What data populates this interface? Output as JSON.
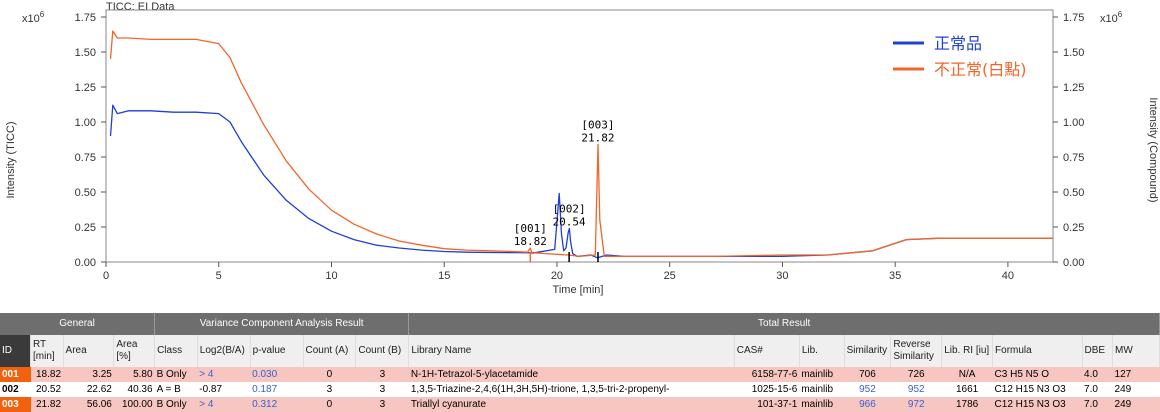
{
  "chart_data": {
    "type": "line",
    "title": "TICC: EI Data",
    "xlabel": "Time [min]",
    "ylabel_left": "Intensity (TICC)",
    "ylabel_right": "Intensity (Compound)",
    "y_multiplier": "x10",
    "y_exponent": "6",
    "xlim": [
      0,
      42
    ],
    "ylim": [
      0,
      1.8
    ],
    "x_ticks": [
      0,
      5,
      10,
      15,
      20,
      25,
      30,
      35,
      40
    ],
    "y_ticks": [
      0.0,
      0.25,
      0.5,
      0.75,
      1.0,
      1.25,
      1.5,
      1.75
    ],
    "y_tick_labels": [
      "0.00",
      "0.25",
      "0.50",
      "0.75",
      "1.00",
      "1.25",
      "1.50",
      "1.75"
    ],
    "legend_position": "top-right",
    "series": [
      {
        "name": "正常品",
        "color": "#1f3fd6",
        "x": [
          0.2,
          0.3,
          0.5,
          1,
          2,
          3,
          4,
          5,
          5.5,
          6,
          7,
          8,
          9,
          10,
          11,
          12,
          13,
          14,
          15,
          16,
          17,
          18,
          19,
          19.9,
          20.1,
          20.2,
          20.3,
          20.4,
          20.5,
          20.55,
          20.6,
          20.7,
          20.9,
          21.5,
          21.8,
          22.2,
          23,
          25,
          27,
          30,
          32,
          34,
          35.5,
          37,
          40,
          42
        ],
        "y": [
          0.9,
          1.12,
          1.06,
          1.08,
          1.08,
          1.07,
          1.07,
          1.06,
          1.0,
          0.86,
          0.62,
          0.44,
          0.31,
          0.22,
          0.16,
          0.12,
          0.1,
          0.085,
          0.075,
          0.07,
          0.068,
          0.067,
          0.066,
          0.09,
          0.49,
          0.2,
          0.08,
          0.1,
          0.21,
          0.24,
          0.15,
          0.06,
          0.04,
          0.05,
          0.03,
          0.05,
          0.04,
          0.04,
          0.04,
          0.04,
          0.05,
          0.08,
          0.16,
          0.17,
          0.17,
          0.17
        ]
      },
      {
        "name": "不正常(白點)",
        "color": "#f2652a",
        "x": [
          0.2,
          0.3,
          0.5,
          1,
          2,
          3,
          4,
          5,
          5.5,
          6,
          7,
          8,
          9,
          10,
          11,
          12,
          13,
          14,
          15,
          16,
          17,
          18,
          18.7,
          18.82,
          18.9,
          19,
          19.5,
          20,
          20.5,
          21,
          21.7,
          21.82,
          21.9,
          22.1,
          23,
          25,
          27,
          30,
          32,
          34,
          35.5,
          37,
          40,
          42
        ],
        "y": [
          1.45,
          1.65,
          1.6,
          1.6,
          1.59,
          1.59,
          1.59,
          1.56,
          1.46,
          1.28,
          0.98,
          0.72,
          0.52,
          0.37,
          0.27,
          0.2,
          0.15,
          0.12,
          0.095,
          0.085,
          0.08,
          0.075,
          0.07,
          0.1,
          0.06,
          0.065,
          0.06,
          0.055,
          0.05,
          0.04,
          0.05,
          0.84,
          0.3,
          0.04,
          0.04,
          0.04,
          0.04,
          0.05,
          0.05,
          0.08,
          0.16,
          0.17,
          0.17,
          0.17
        ]
      }
    ],
    "annotations": [
      {
        "id": "[001]",
        "rt": "18.82",
        "x": 18.82,
        "y": 0.1
      },
      {
        "id": "[002]",
        "rt": "20.54",
        "x": 20.54,
        "y": 0.24
      },
      {
        "id": "[003]",
        "rt": "21.82",
        "x": 21.82,
        "y": 0.84
      }
    ]
  },
  "table": {
    "groups": [
      {
        "label": "General"
      },
      {
        "label": "Variance Component Analysis Result"
      },
      {
        "label": "Total Result"
      }
    ],
    "columns": [
      "ID",
      "RT [min]",
      "Area",
      "Area [%]",
      "Class",
      "Log2(B/A)",
      "p-value",
      "Count (A)",
      "Count (B)",
      "Library Name",
      "CAS#",
      "Lib.",
      "Similarity",
      "Reverse Similarity",
      "Lib. RI [iu]",
      "Formula",
      "DBE",
      "MW"
    ],
    "rows": [
      [
        "001",
        "18.82",
        "3.25",
        "5.80",
        "B Only",
        "> 4",
        "0.030",
        "0",
        "3",
        "N-1H-Tetrazol-5-ylacetamide",
        "6158-77-6",
        "mainlib",
        "706",
        "726",
        "N/A",
        "C3 H5 N5 O",
        "4.0",
        "127"
      ],
      [
        "002",
        "20.52",
        "22.62",
        "40.36",
        "A = B",
        "-0.87",
        "0.187",
        "3",
        "3",
        "1,3,5-Triazine-2,4,6(1H,3H,5H)-trione, 1,3,5-tri-2-propenyl-",
        "1025-15-6",
        "mainlib",
        "952",
        "952",
        "1661",
        "C12 H15 N3 O3",
        "7.0",
        "249"
      ],
      [
        "003",
        "21.82",
        "56.06",
        "100.00",
        "B Only",
        "> 4",
        "0.312",
        "0",
        "3",
        "Triallyl cyanurate",
        "101-37-1",
        "mainlib",
        "966",
        "972",
        "1786",
        "C12 H15 N3 O3",
        "7.0",
        "249"
      ]
    ]
  }
}
